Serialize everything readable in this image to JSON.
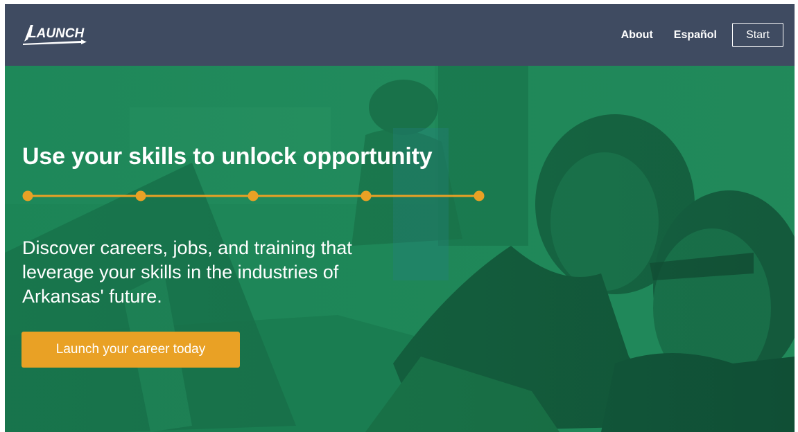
{
  "navbar": {
    "logo_text": "LAUNCH",
    "links": [
      {
        "label": "About"
      },
      {
        "label": "Español"
      }
    ],
    "start_label": "Start"
  },
  "hero": {
    "headline": "Use your skills to unlock opportunity",
    "subheadline": "Discover careers, jobs, and training that leverage your skills in the industries of Arkansas' future.",
    "cta_label": "Launch your career today",
    "progress_steps": 5
  },
  "colors": {
    "navbar_bg": "#3f4b61",
    "hero_green": "#1f8759",
    "accent_orange": "#e9a125",
    "text_white": "#ffffff"
  },
  "icons": {
    "logo": "launch-logo-icon",
    "progress": "step-dots-icon"
  }
}
